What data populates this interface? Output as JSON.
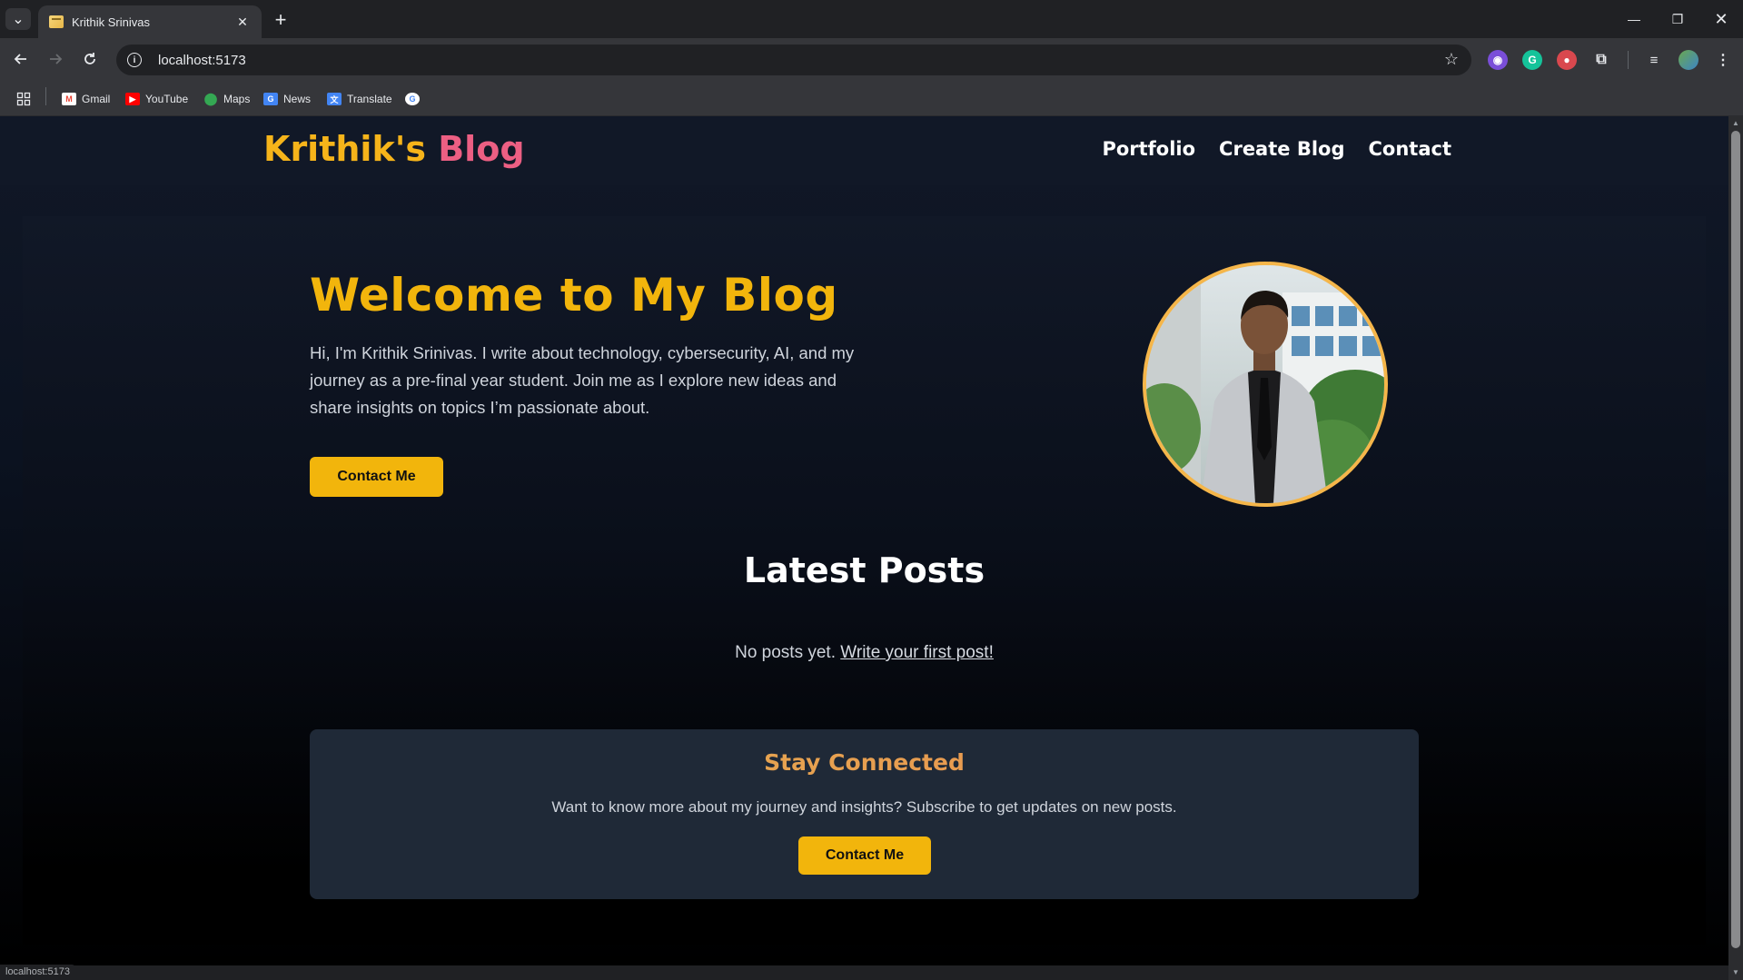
{
  "browser": {
    "tab_title": "Krithik Srinivas",
    "url": "localhost:5173",
    "status_url": "localhost:5173",
    "bookmarks": [
      {
        "label": "Gmail",
        "icon": "gmail-icon"
      },
      {
        "label": "YouTube",
        "icon": "youtube-icon"
      },
      {
        "label": "Maps",
        "icon": "maps-icon"
      },
      {
        "label": "News",
        "icon": "news-icon"
      },
      {
        "label": "Translate",
        "icon": "translate-icon"
      }
    ]
  },
  "site": {
    "logo_part1": "Krithik's",
    "logo_part2": "Blog",
    "nav": [
      "Portfolio",
      "Create Blog",
      "Contact"
    ]
  },
  "hero": {
    "title": "Welcome to My Blog",
    "description": "Hi, I'm Krithik Srinivas. I write about technology, cybersecurity, AI, and my journey as a pre-final year student. Join me as I explore new ideas and share insights on topics I’m passionate about.",
    "button": "Contact Me"
  },
  "posts": {
    "title": "Latest Posts",
    "empty_text": "No posts yet.",
    "empty_link": "Write your first post!"
  },
  "subscribe": {
    "title": "Stay Connected",
    "text": "Want to know more about my journey and insights? Subscribe to get updates on new posts.",
    "button": "Contact Me"
  },
  "colors": {
    "accent_yellow": "#f2b50c",
    "logo_pink": "#ec5f83",
    "header_bg": "#111827",
    "card_bg": "#1f2937"
  }
}
